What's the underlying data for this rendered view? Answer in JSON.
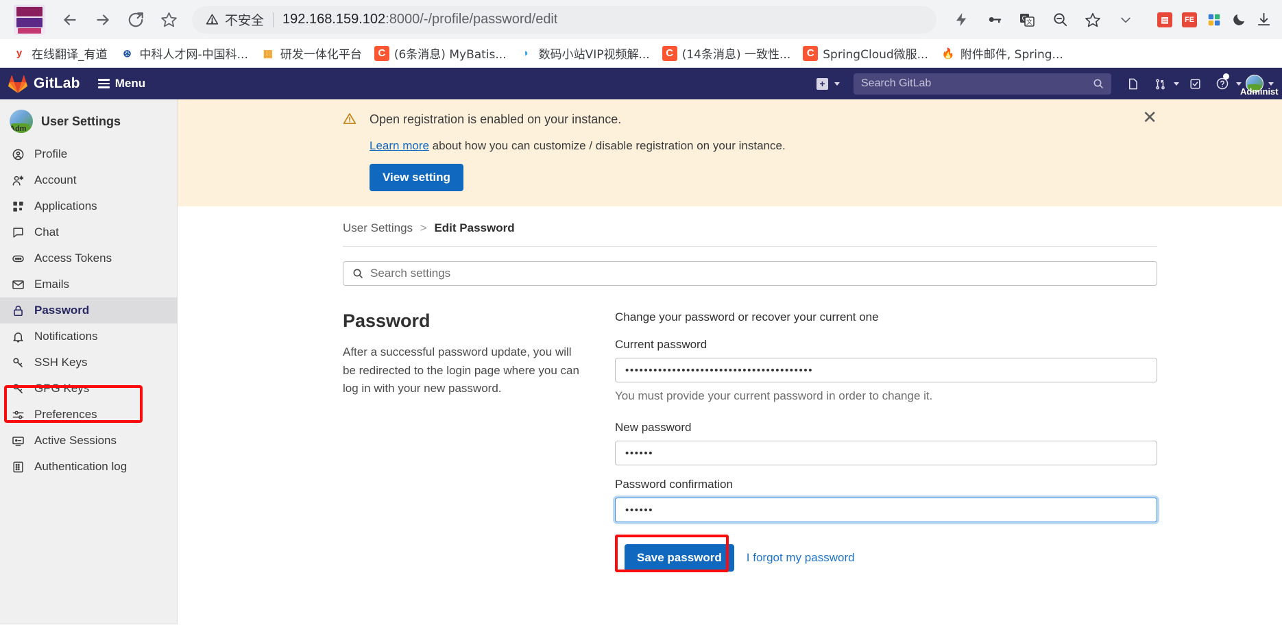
{
  "browser": {
    "url_host": "192.168.159.102",
    "url_port": ":8000",
    "url_path": "/-/profile/password/edit",
    "insecure_label": "不安全",
    "nav": {
      "back": "Back",
      "forward": "Forward",
      "reload": "Reload",
      "bookmark": "Bookmark this page"
    },
    "toolbar_icons": [
      "lightning-icon",
      "key-icon",
      "translate-icon",
      "zoom-out-icon",
      "star-icon",
      "chevron-down-icon"
    ],
    "right_icons": [
      "extension-red-icon",
      "extension-fe-icon",
      "extension-puzzle-icon",
      "dark-mode-icon",
      "download-icon"
    ],
    "bookmarks": [
      {
        "label": "在线翻译_有道",
        "icon": "y-icon",
        "icon_char": "y",
        "color": "#e8332a",
        "bg": "transparent"
      },
      {
        "label": "中科人才网-中国科...",
        "icon": "globe-icon",
        "icon_char": "⊛",
        "color": "#1b50a0",
        "bg": "transparent"
      },
      {
        "label": "研发一体化平台",
        "icon": "app-icon",
        "icon_char": "▦",
        "color": "#f0a32c",
        "bg": "transparent"
      },
      {
        "label": "(6条消息) MyBatis...",
        "icon": "csdn-icon",
        "icon_char": "C",
        "color": "#ffffff",
        "bg": "#fc5531"
      },
      {
        "label": "数码小站VIP视频解...",
        "icon": "video-icon",
        "icon_char": "◗",
        "color": "#2ba6e8",
        "bg": "transparent"
      },
      {
        "label": "(14条消息) 一致性...",
        "icon": "csdn-icon",
        "icon_char": "C",
        "color": "#ffffff",
        "bg": "#fc5531"
      },
      {
        "label": "SpringCloud微服...",
        "icon": "csdn-icon",
        "icon_char": "C",
        "color": "#ffffff",
        "bg": "#fc5531"
      },
      {
        "label": "附件邮件, Spring...",
        "icon": "flame-icon",
        "icon_char": "🔥",
        "color": "#e8493a",
        "bg": "transparent"
      }
    ]
  },
  "navbar": {
    "brand": "GitLab",
    "menu_label": "Menu",
    "search_placeholder": "Search GitLab",
    "user_name": "Administ",
    "icons": [
      "plus-icon",
      "issues-icon",
      "merge-requests-icon",
      "todos-icon",
      "help-icon"
    ]
  },
  "sidebar": {
    "title": "User Settings",
    "avatar_label": "Adm",
    "items": [
      {
        "label": "Profile",
        "icon": "user-icon",
        "active": false
      },
      {
        "label": "Account",
        "icon": "account-icon",
        "active": false
      },
      {
        "label": "Applications",
        "icon": "applications-icon",
        "active": false
      },
      {
        "label": "Chat",
        "icon": "chat-icon",
        "active": false
      },
      {
        "label": "Access Tokens",
        "icon": "token-icon",
        "active": false
      },
      {
        "label": "Emails",
        "icon": "email-icon",
        "active": false
      },
      {
        "label": "Password",
        "icon": "lock-icon",
        "active": true
      },
      {
        "label": "Notifications",
        "icon": "bell-icon",
        "active": false
      },
      {
        "label": "SSH Keys",
        "icon": "key-icon",
        "active": false
      },
      {
        "label": "GPG Keys",
        "icon": "key-icon",
        "active": false
      },
      {
        "label": "Preferences",
        "icon": "preferences-icon",
        "active": false
      },
      {
        "label": "Active Sessions",
        "icon": "monitor-icon",
        "active": false
      },
      {
        "label": "Authentication log",
        "icon": "log-icon",
        "active": false
      }
    ]
  },
  "alert": {
    "title": "Open registration is enabled on your instance.",
    "link_text": "Learn more",
    "body_text": " about how you can customize / disable registration on your instance.",
    "button": "View setting",
    "close": "✕",
    "bg_color": "#fdf1dc",
    "icon": "warning-triangle-icon"
  },
  "breadcrumb": {
    "parent": "User Settings",
    "separator": ">",
    "current": "Edit Password"
  },
  "settings_search": {
    "placeholder": "Search settings",
    "icon": "search-icon"
  },
  "password_section": {
    "heading": "Password",
    "description": "After a successful password update, you will be redirected to the login page where you can log in with your new password.",
    "intro": "Change your password or recover your current one",
    "current_label": "Current password",
    "current_value": "••••••••••••••••••••••••••••••••••••••••",
    "current_helper": "You must provide your current password in order to change it.",
    "new_label": "New password",
    "new_value": "••••••",
    "confirm_label": "Password confirmation",
    "confirm_value": "••••••",
    "save_button": "Save password",
    "forgot_link": "I forgot my password",
    "accent_color": "#1068bf",
    "highlight_color": "#fb0b0b"
  }
}
